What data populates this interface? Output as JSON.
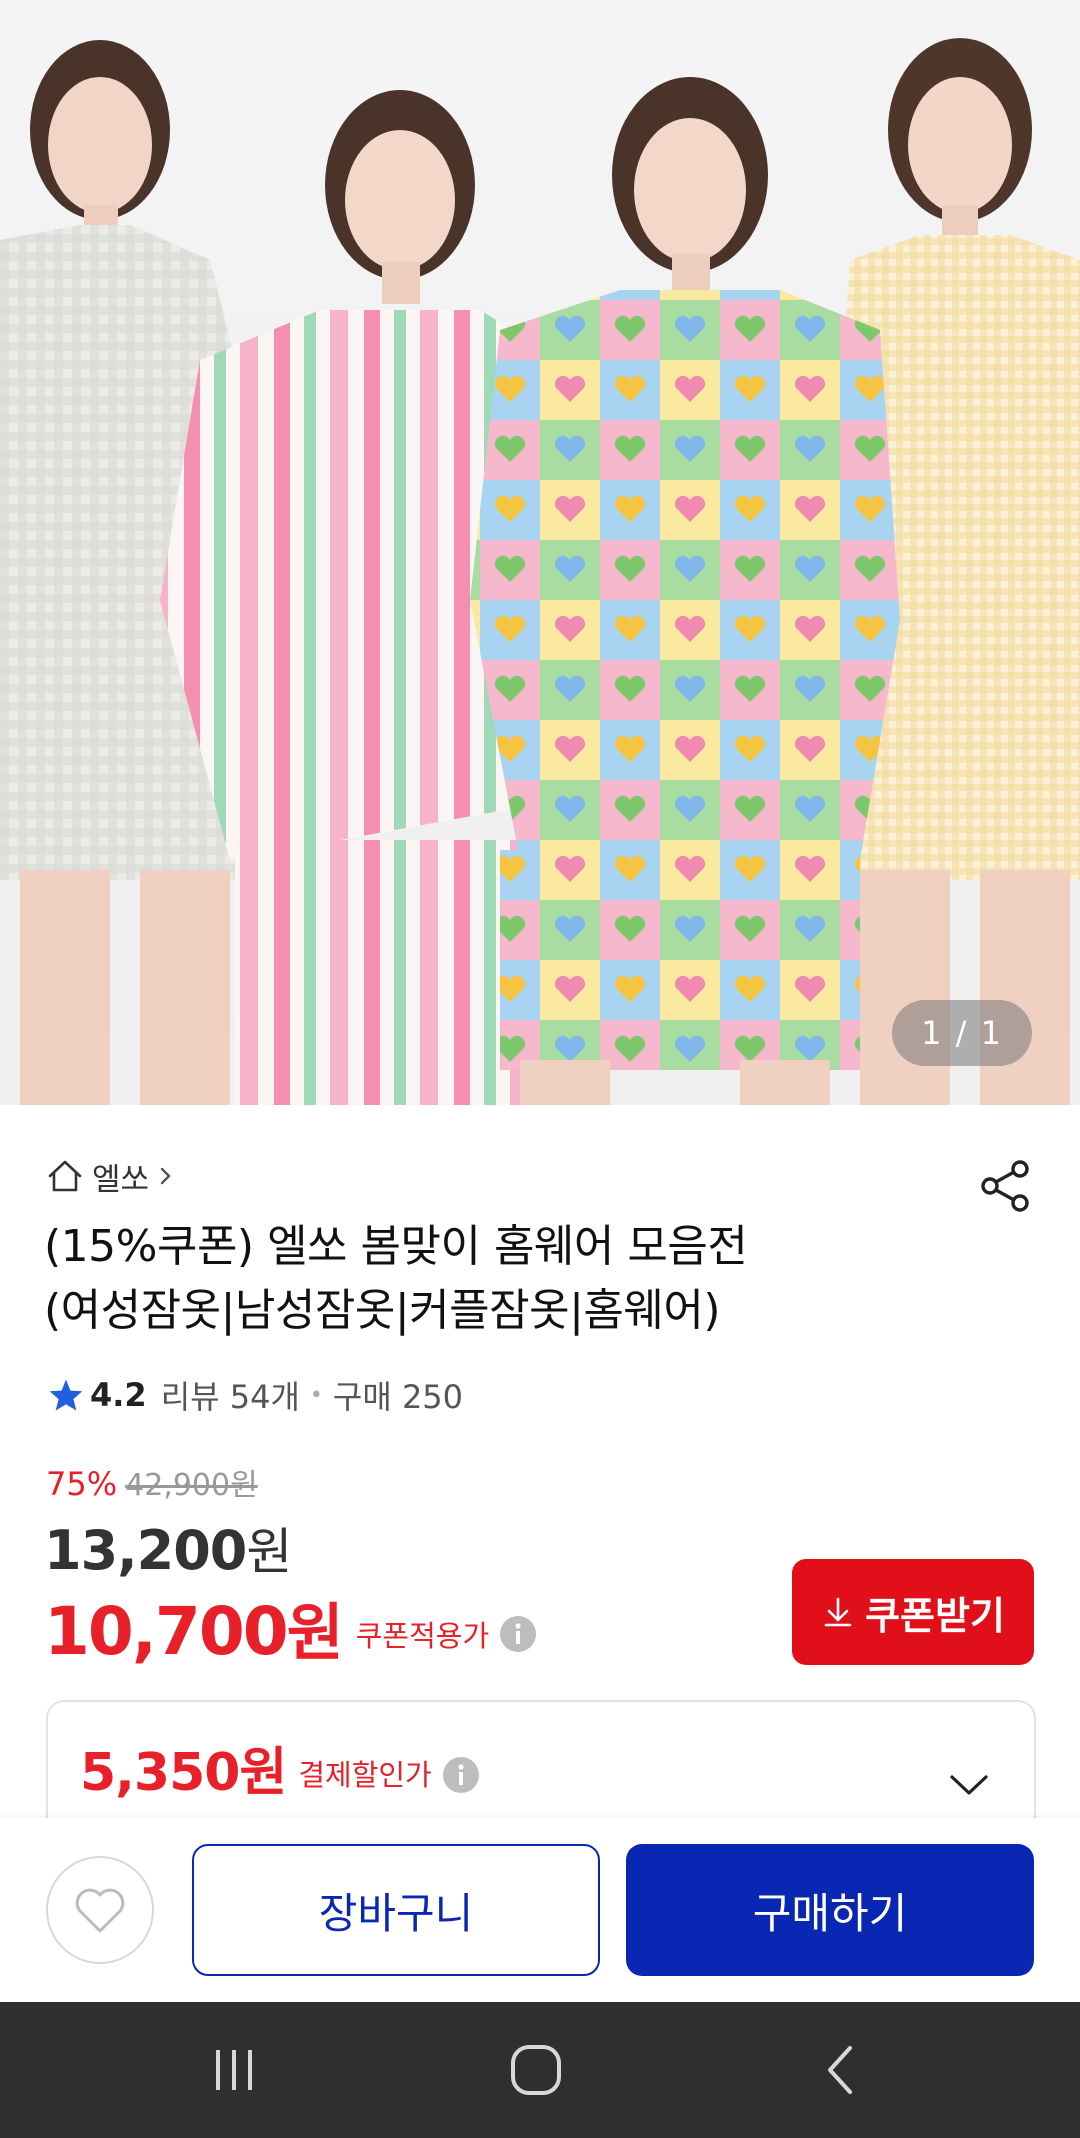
{
  "hero": {
    "page_counter": "1 / 1"
  },
  "store": {
    "name": "엘쏘"
  },
  "product": {
    "title_line1": "(15%쿠폰) 엘쏘 봄맞이 홈웨어 모음전",
    "title_line2": "(여성잠옷|남성잠옷|커플잠옷|홈웨어)",
    "rating": "4.2",
    "reviews": "리뷰 54개",
    "purchases": "구매 250",
    "discount_rate": "75%",
    "original_price": "42,900원",
    "sale_price_number": "13,200",
    "sale_price_unit": "원",
    "coupon_price_number": "10,700",
    "coupon_price_unit": "원",
    "coupon_price_label": "쿠폰적용가",
    "coupon_button": "쿠폰받기",
    "pay_price_number": "5,350",
    "pay_price_unit": "원",
    "pay_price_label": "결제할인가"
  },
  "actions": {
    "cart": "장바구니",
    "buy": "구매하기"
  },
  "colors": {
    "accent_red": "#e8202a",
    "coupon_button_bg": "#e00f1a",
    "brand_blue": "#0a27b4",
    "nav_bar": "#2f2f31"
  }
}
